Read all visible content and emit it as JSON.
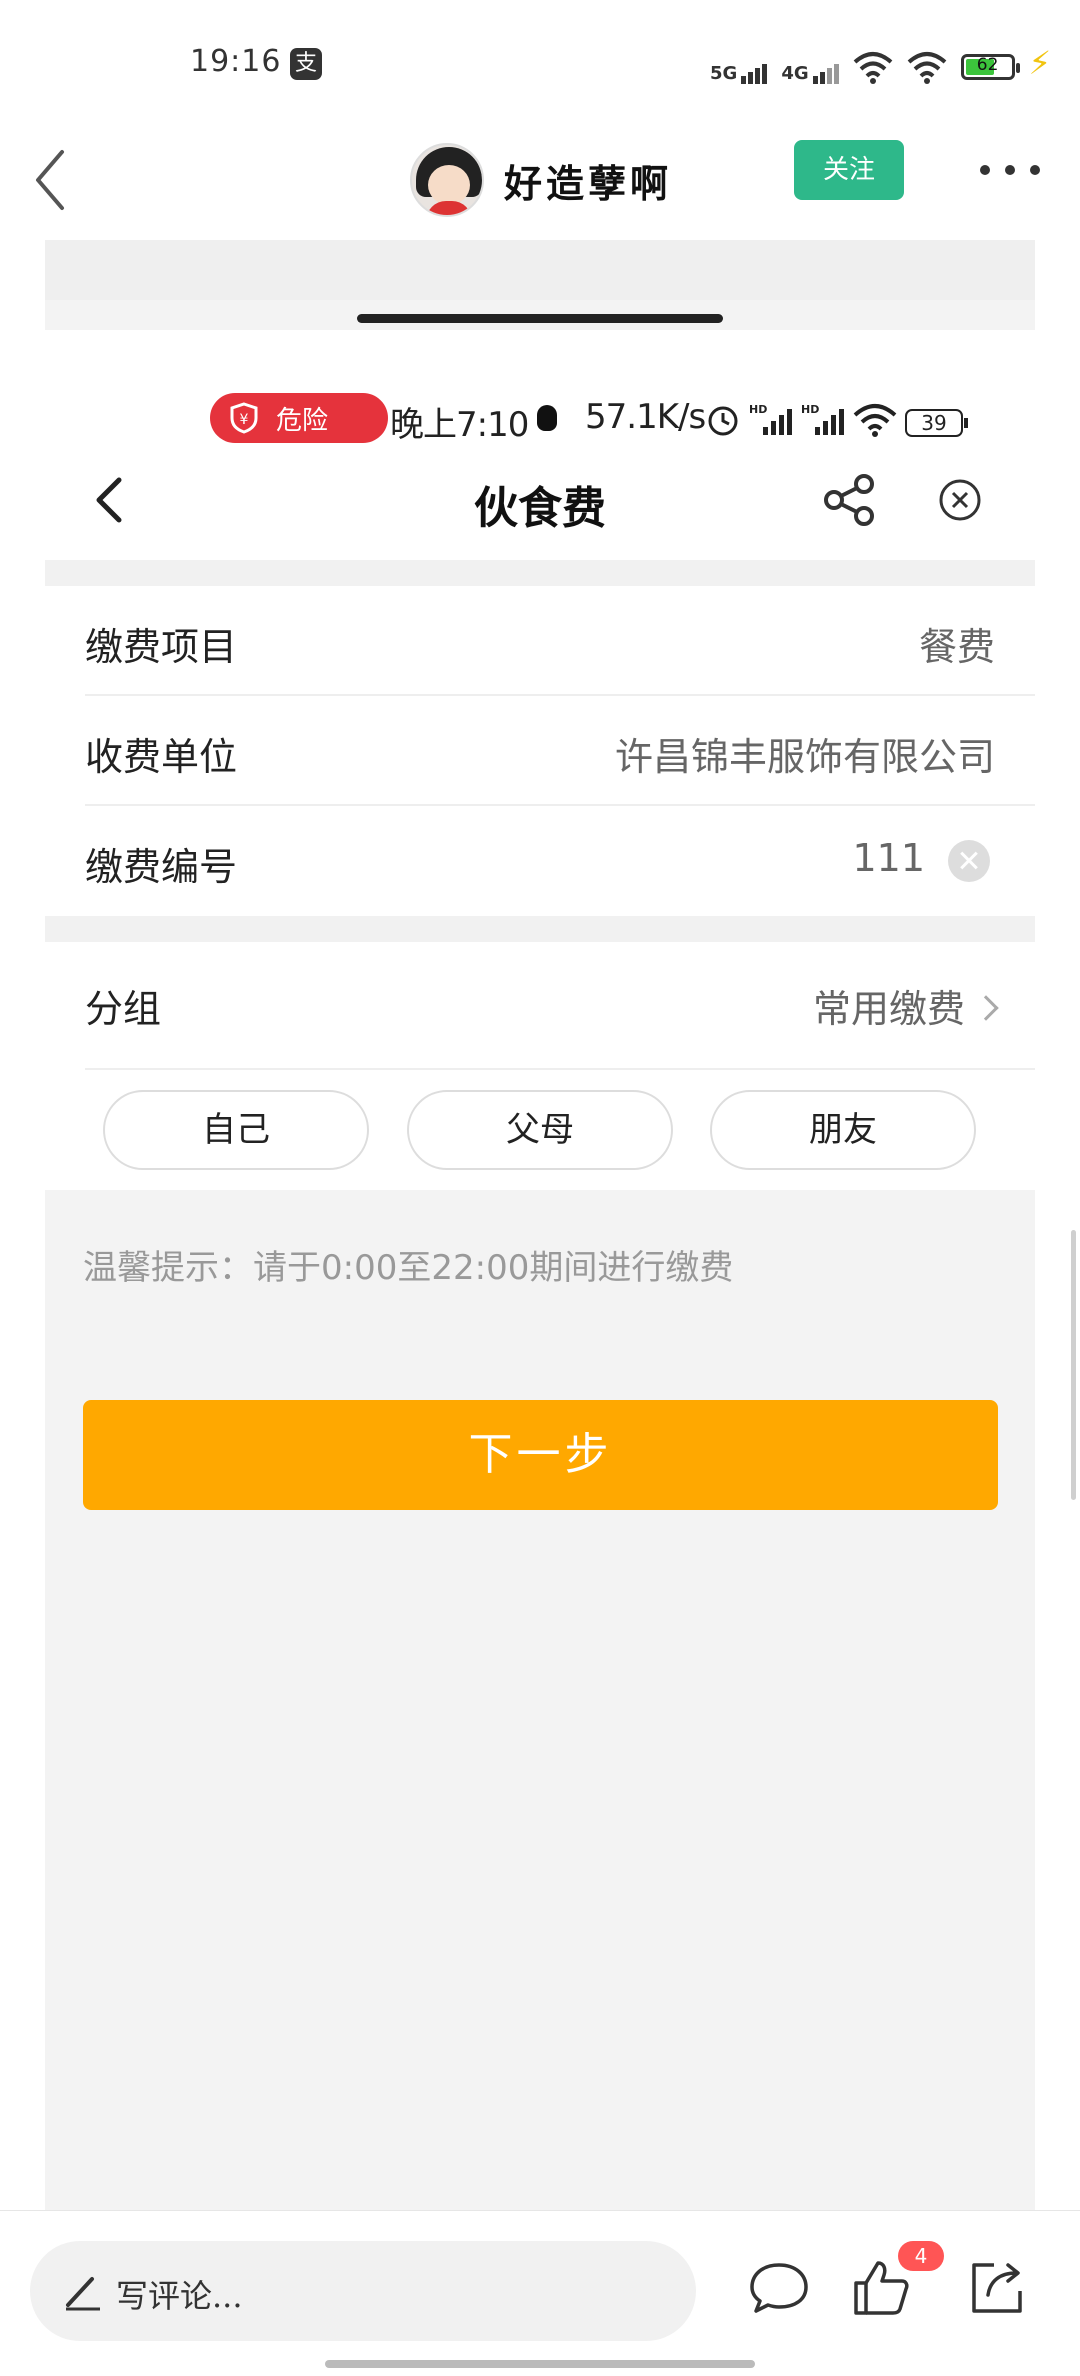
{
  "status_bar": {
    "time": "19:16",
    "app_icon": "支",
    "network_1": "5G",
    "network_2": "4G",
    "battery": "62"
  },
  "header": {
    "author_name": "好造孽啊",
    "follow_label": "关注"
  },
  "inner_status": {
    "danger_label": "危险",
    "time": "晚上7:10",
    "speed": "57.1K/s",
    "battery": "39"
  },
  "inner_nav": {
    "title": "伙食费"
  },
  "form": {
    "rows": [
      {
        "label": "缴费项目",
        "value": "餐费"
      },
      {
        "label": "收费单位",
        "value": "许昌锦丰服饰有限公司"
      },
      {
        "label": "缴费编号",
        "value": "111"
      }
    ],
    "group": {
      "label": "分组",
      "value": "常用缴费"
    },
    "chips": [
      "自己",
      "父母",
      "朋友"
    ],
    "tip": "温馨提示：请于0:00至22:00期间进行缴费",
    "next_label": "下一步"
  },
  "bottom_bar": {
    "comment_placeholder": "写评论...",
    "like_count": "4"
  },
  "icons": {
    "back": "back-chevron-icon",
    "share": "share-icon",
    "close": "close-circle-icon",
    "comment": "speech-bubble-icon",
    "like": "thumbs-up-icon",
    "forward": "forward-share-icon"
  },
  "colors": {
    "accent_orange": "#ffa800",
    "follow_green": "#2eb88a",
    "danger_red": "#e5333c",
    "badge_red": "#ff5555"
  }
}
